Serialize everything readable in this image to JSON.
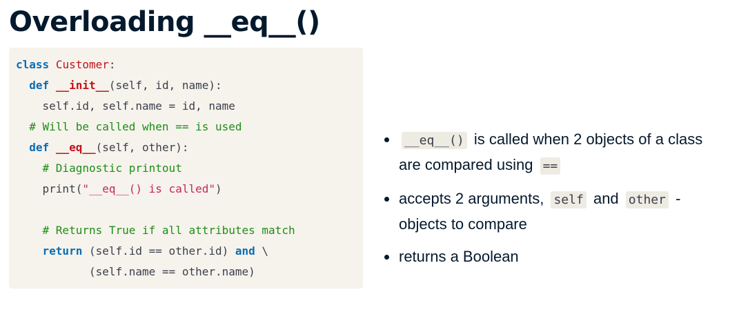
{
  "title": "Overloading __eq__()",
  "code": {
    "line1": {
      "kw": "class",
      "space": " ",
      "name": "Customer",
      "rest": ":"
    },
    "line2": {
      "indent": "  ",
      "kw": "def",
      "space": " ",
      "name": "__init__",
      "rest": "(self, id, name):"
    },
    "line3": {
      "text": "    self.id, self.name = id, name"
    },
    "line4": {
      "indent": "  ",
      "comment": "# Will be called when == is used"
    },
    "line5": {
      "indent": "  ",
      "kw": "def",
      "space": " ",
      "name": "__eq__",
      "rest": "(self, other):"
    },
    "line6": {
      "indent": "    ",
      "comment": "# Diagnostic printout"
    },
    "line7": {
      "pre": "    print(",
      "str": "\"__eq__() is called\"",
      "post": ")"
    },
    "line8": {
      "text": ""
    },
    "line9": {
      "indent": "    ",
      "comment": "# Returns True if all attributes match"
    },
    "line10": {
      "indent": "    ",
      "kw": "return",
      "mid": " (self.id == other.id) ",
      "kw2": "and",
      "post": " \\"
    },
    "line11": {
      "text": "           (self.name == other.name)"
    }
  },
  "bullets": {
    "b1": {
      "code1": "__eq__()",
      "text1": "is called when 2 objects of a class are compared using",
      "code2": "=="
    },
    "b2": {
      "text1": "accepts 2 arguments,",
      "code1": "self",
      "text2": "and",
      "code2": "other",
      "text3": "- objects to compare"
    },
    "b3": {
      "text1": "returns a Boolean"
    }
  }
}
